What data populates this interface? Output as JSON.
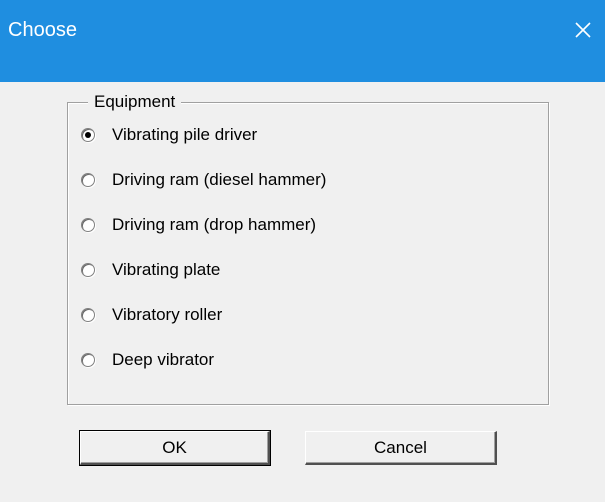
{
  "window": {
    "title": "Choose",
    "close_icon": "close-icon"
  },
  "colors": {
    "titlebar": "#1f8ee0",
    "dialog_background": "#f0f0f0",
    "title_text": "#ffffff"
  },
  "group": {
    "label": "Equipment",
    "options": [
      {
        "label": "Vibrating pile driver",
        "selected": true
      },
      {
        "label": "Driving ram (diesel hammer)",
        "selected": false
      },
      {
        "label": "Driving ram (drop hammer)",
        "selected": false
      },
      {
        "label": "Vibrating plate",
        "selected": false
      },
      {
        "label": "Vibratory roller",
        "selected": false
      },
      {
        "label": "Deep vibrator",
        "selected": false
      }
    ]
  },
  "buttons": {
    "ok_label": "OK",
    "cancel_label": "Cancel"
  }
}
